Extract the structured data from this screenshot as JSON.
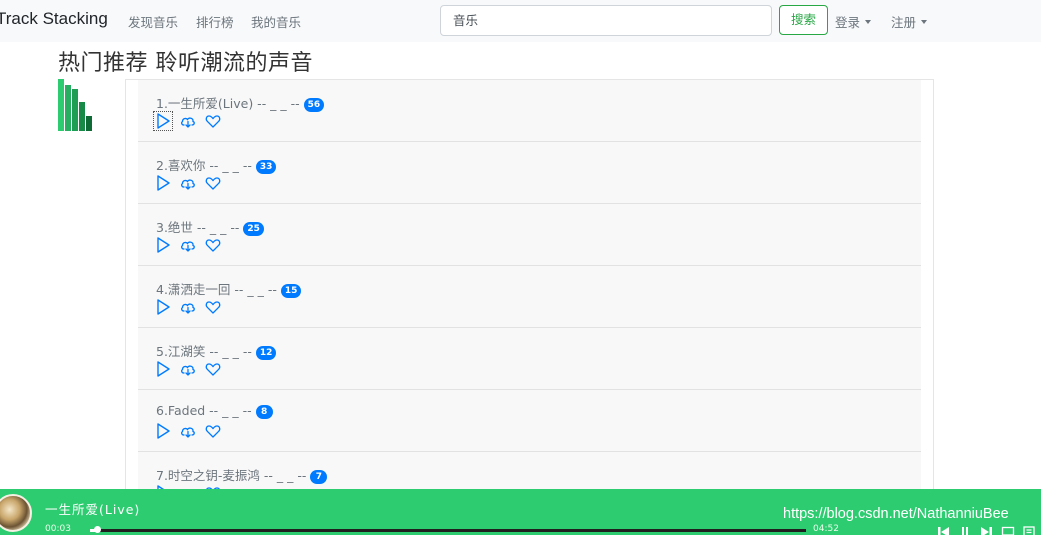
{
  "navbar": {
    "brand": "Track Stacking",
    "links": [
      "发现音乐",
      "排行榜",
      "我的音乐"
    ],
    "search_value": "音乐",
    "search_button": "搜索",
    "login": "登录",
    "register": "注册"
  },
  "page_title": "热门推荐 聆听潮流的声音",
  "songs": [
    {
      "title": "1.一生所爱(Live) -- _ _ --",
      "count": "56"
    },
    {
      "title": "2.喜欢你 -- _ _ --",
      "count": "33"
    },
    {
      "title": "3.绝世 -- _ _ --",
      "count": "25"
    },
    {
      "title": "4.潇洒走一回 -- _ _ --",
      "count": "15"
    },
    {
      "title": "5.江湖笑 -- _ _ --",
      "count": "12"
    },
    {
      "title": "6.Faded -- _ _ --",
      "count": "8"
    },
    {
      "title": "7.时空之钥-麦振鸿 -- _ _ --",
      "count": "7"
    }
  ],
  "player": {
    "now_playing": "一生所爱(Live)",
    "current_time": "00:03",
    "duration": "04:52",
    "progress_fraction": 0.01,
    "watermark": "https://blog.csdn.net/NathanniuBee"
  },
  "colors": {
    "accent_green": "#2ecc71",
    "badge_blue": "#007bff",
    "search_button_green": "#28a745"
  },
  "icons": {
    "song_actions": [
      "play-icon",
      "download-cloud-icon",
      "heart-icon"
    ],
    "player_controls": [
      "skip-back-icon",
      "pause-icon",
      "skip-forward-icon",
      "screen-icon",
      "playlist-icon"
    ]
  }
}
